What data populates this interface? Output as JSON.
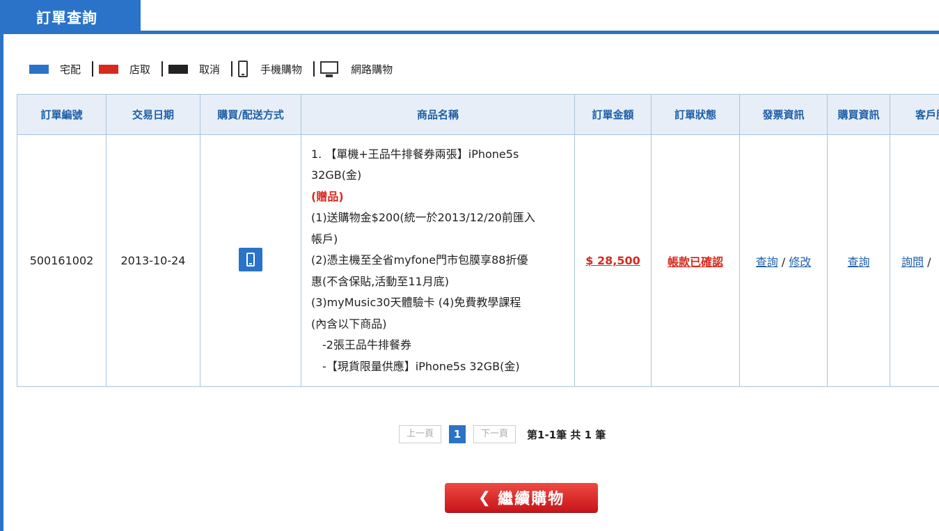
{
  "header": {
    "title": "訂單查詢"
  },
  "legend": [
    {
      "label": "宅配",
      "color": "#2a73c8"
    },
    {
      "label": "店取",
      "color": "#d72a1f"
    },
    {
      "label": "取消",
      "color": "#222222"
    },
    {
      "label": "手機購物",
      "icon": "phone-icon"
    },
    {
      "label": "網路購物",
      "icon": "desktop-icon"
    }
  ],
  "table": {
    "columns": [
      "訂單編號",
      "交易日期",
      "購買/配送方式",
      "商品名稱",
      "訂單金額",
      "訂單狀態",
      "發票資訊",
      "購買資訊",
      "客戶服"
    ],
    "row": {
      "order_no": "500161002",
      "date": "2013-10-24",
      "method_icon": "mobile-purchase-icon",
      "product_lines": [
        "1. 【單機+王品牛排餐券兩張】iPhone5s",
        "32GB(金)",
        "(贈品)",
        "(1)送購物金$200(統一於2013/12/20前匯入",
        "帳戶)",
        "(2)憑主機至全省myfone門市包膜享88折優",
        "惠(不含保貼,活動至11月底)",
        "(3)myMusic30天體驗卡 (4)免費教學課程",
        "(內含以下商品)",
        "-2張王品牛排餐券",
        "-【現貨限量供應】iPhone5s 32GB(金)"
      ],
      "amount": "$ 28,500",
      "status": "帳款已確認",
      "invoice_query": "查詢",
      "invoice_sep": " / ",
      "invoice_edit": "修改",
      "purchase_query": "查詢",
      "service_ask": "詢問",
      "service_sep": " / "
    }
  },
  "pager": {
    "prev": "上一頁",
    "current": "1",
    "next": "下一頁",
    "info": "第1-1筆 共 1 筆"
  },
  "continue_button": {
    "label": "繼續購物",
    "chevron": "❮"
  }
}
